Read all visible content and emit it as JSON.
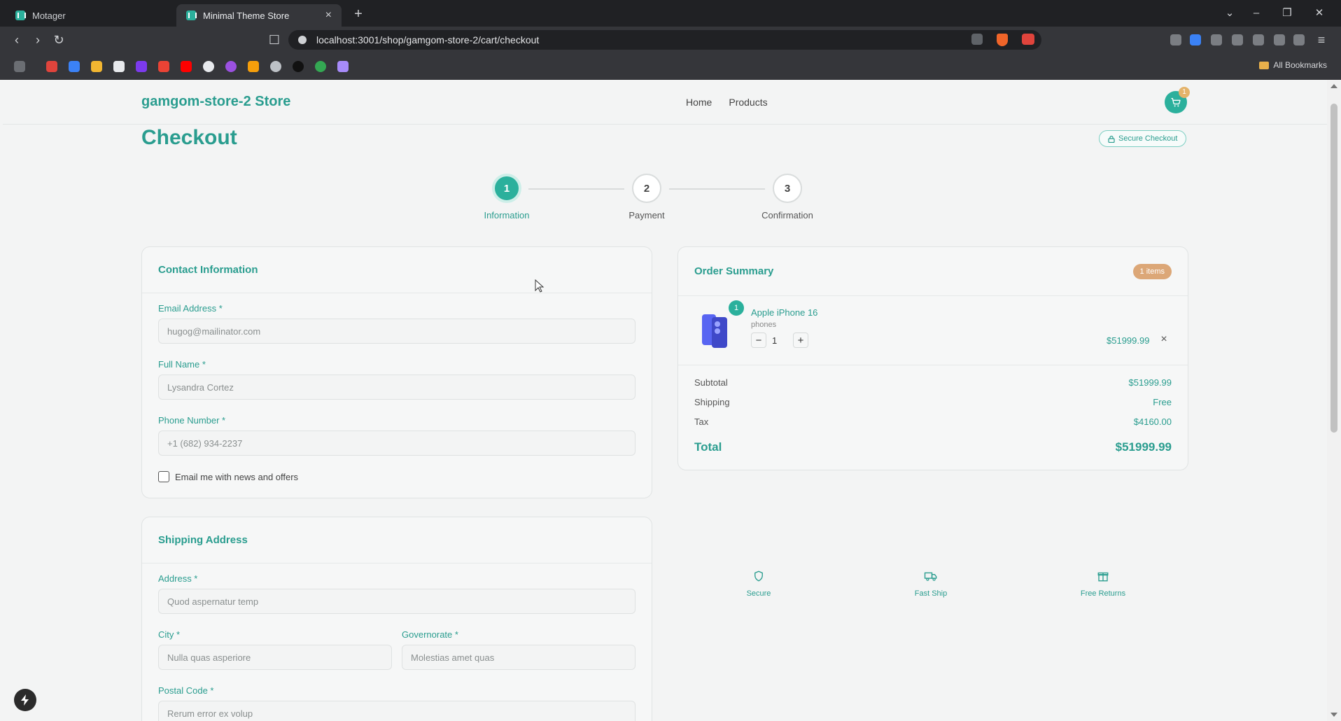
{
  "browser": {
    "tabs": [
      {
        "title": "Motager",
        "active": false
      },
      {
        "title": "Minimal Theme Store",
        "active": true
      }
    ],
    "url": "localhost:3001/shop/gamgom-store-2/cart/checkout",
    "bookmarks_label": "All Bookmarks"
  },
  "header": {
    "brand": "gamgom-store-2 Store",
    "nav": [
      {
        "label": "Home"
      },
      {
        "label": "Products"
      }
    ],
    "cart_count": "1"
  },
  "page": {
    "title": "Checkout",
    "secure_label": "Secure Checkout"
  },
  "steps": [
    {
      "number": "1",
      "label": "Information",
      "active": true
    },
    {
      "number": "2",
      "label": "Payment",
      "active": false
    },
    {
      "number": "3",
      "label": "Confirmation",
      "active": false
    }
  ],
  "contact": {
    "title": "Contact Information",
    "email_label": "Email Address *",
    "email_value": "hugog@mailinator.com",
    "name_label": "Full Name *",
    "name_value": "Lysandra Cortez",
    "phone_label": "Phone Number *",
    "phone_value": "+1 (682) 934-2237",
    "newsletter_label": "Email me with news and offers"
  },
  "shipping": {
    "title": "Shipping Address",
    "address_label": "Address *",
    "address_value": "Quod aspernatur temp",
    "city_label": "City *",
    "city_value": "Nulla quas asperiore",
    "governorate_label": "Governorate *",
    "governorate_value": "Molestias amet quas",
    "postal_label": "Postal Code *",
    "postal_value": "Rerum error ex volup"
  },
  "summary": {
    "title": "Order Summary",
    "items_badge": "1 items",
    "item": {
      "name": "Apple iPhone 16",
      "category": "phones",
      "quantity": "1",
      "price": "$51999.99"
    },
    "subtotal_label": "Subtotal",
    "subtotal_value": "$51999.99",
    "shipping_label": "Shipping",
    "shipping_value": "Free",
    "tax_label": "Tax",
    "tax_value": "$4160.00",
    "total_label": "Total",
    "total_value": "$51999.99"
  },
  "trust": [
    {
      "label": "Secure",
      "icon": "shield-icon"
    },
    {
      "label": "Fast Ship",
      "icon": "truck-icon"
    },
    {
      "label": "Free Returns",
      "icon": "gift-icon"
    }
  ],
  "colors": {
    "primary": "#2bb09c",
    "primary_text": "#2a9d8f",
    "badge": "#dca777"
  }
}
